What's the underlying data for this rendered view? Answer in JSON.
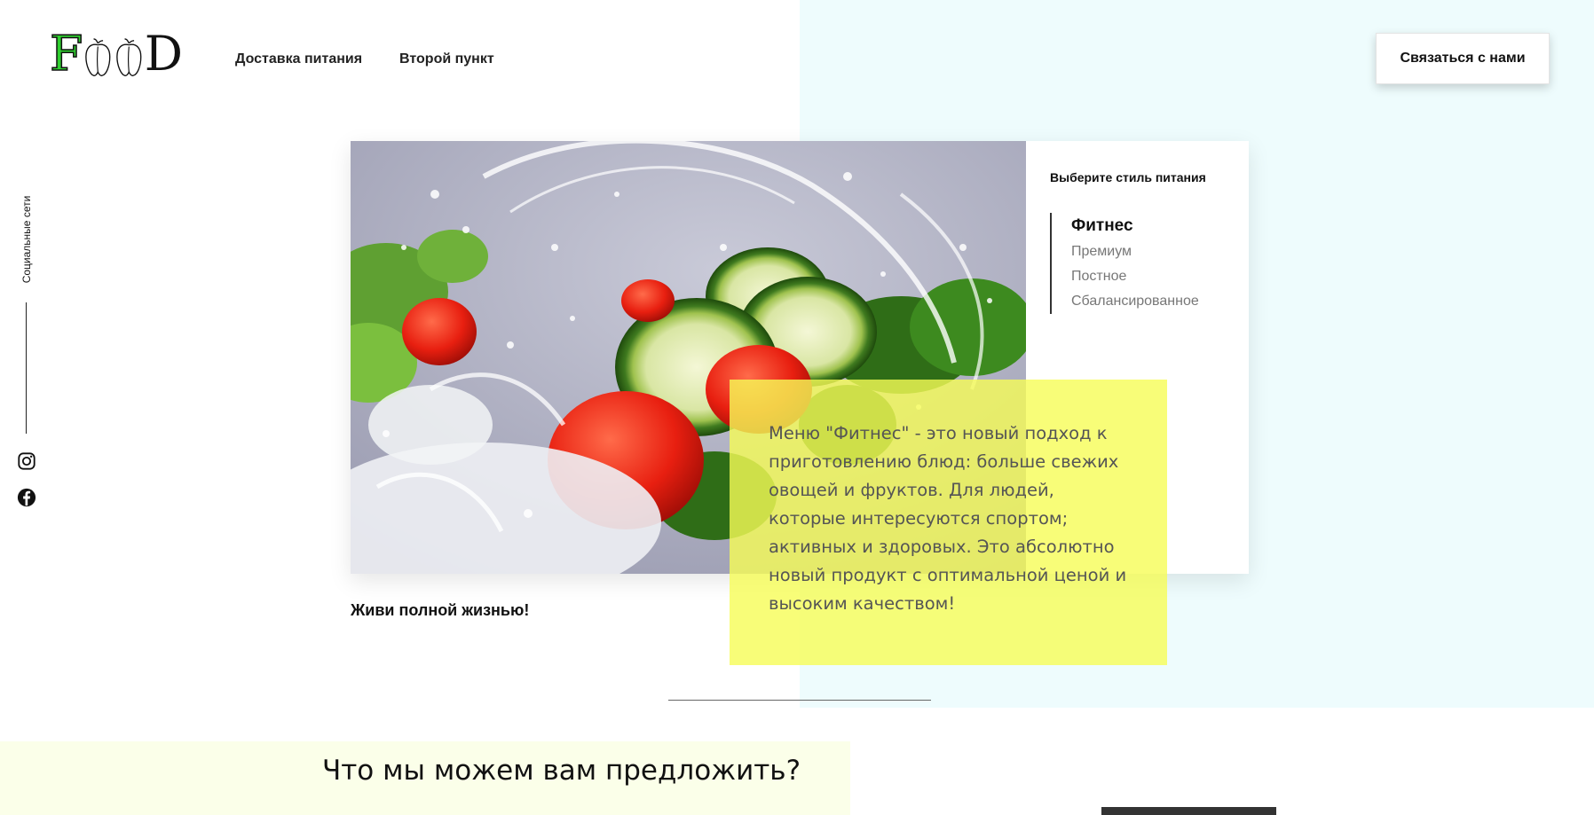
{
  "header": {
    "logo_alt": "FOOD",
    "nav": [
      {
        "label": "Доставка питания"
      },
      {
        "label": "Второй пункт"
      }
    ],
    "contact_label": "Связаться с нами"
  },
  "social": {
    "label": "Социальные сети",
    "icons": [
      "instagram-icon",
      "facebook-icon"
    ]
  },
  "card": {
    "image_subject": "salad-with-water-splash",
    "side_title": "Выберите стиль питания",
    "styles": [
      {
        "label": "Фитнес",
        "active": true
      },
      {
        "label": "Премиум",
        "active": false
      },
      {
        "label": "Постное",
        "active": false
      },
      {
        "label": "Сбалансированное",
        "active": false
      }
    ]
  },
  "description": "Меню \"Фитнес\" - это новый подход к приготовлению блюд: больше свежих овощей и фруктов. Для людей, которые интересуются спортом; активных и здоровых. Это абсолютно новый продукт с оптимальной ценой и высоким качеством!",
  "tagline": "Живи полной жизнью!",
  "section_title": "Что мы можем вам предложить?",
  "colors": {
    "accent_green": "#4ded3b",
    "highlight_yellow": "#f6fc56",
    "bg_cyan": "#eefcfd",
    "bg_lime": "#fbffe9"
  }
}
